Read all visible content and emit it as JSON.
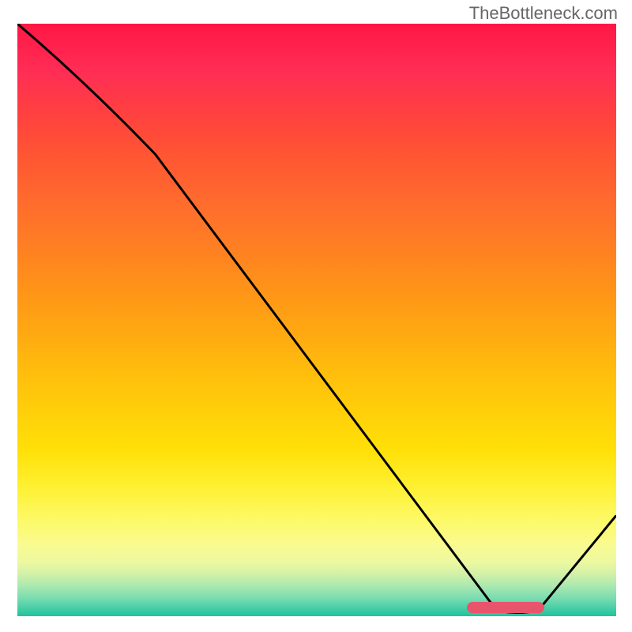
{
  "watermark": "TheBottleneck.com",
  "chart_data": {
    "type": "line",
    "title": "",
    "xlabel": "",
    "ylabel": "",
    "x_range": [
      0,
      100
    ],
    "y_range": [
      0,
      100
    ],
    "curve_points": [
      {
        "x": 0,
        "y": 100
      },
      {
        "x": 23,
        "y": 78
      },
      {
        "x": 80,
        "y": 1
      },
      {
        "x": 87,
        "y": 1
      },
      {
        "x": 100,
        "y": 17
      }
    ],
    "marker": {
      "x_start": 75,
      "x_end": 88,
      "y": 1.5,
      "color": "#e8546b"
    },
    "gradient_colors": {
      "top": "#ff1744",
      "mid_upper": "#ff8022",
      "mid": "#ffce0a",
      "mid_lower": "#fdfa6a",
      "bottom": "#1ec49c"
    }
  }
}
